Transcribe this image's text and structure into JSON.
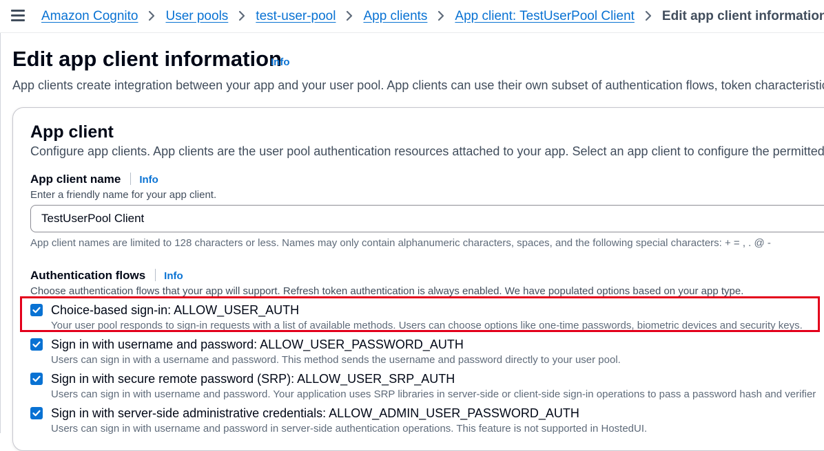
{
  "breadcrumbs": [
    {
      "label": "Amazon Cognito"
    },
    {
      "label": "User pools"
    },
    {
      "label": "test-user-pool"
    },
    {
      "label": "App clients"
    },
    {
      "label": "App client: TestUserPool Client"
    },
    {
      "label": "Edit app client information"
    }
  ],
  "page": {
    "title": "Edit app client information",
    "info_label": "Info",
    "description": "App clients create integration between your app and your user pool. App clients can use their own subset of authentication flows, token characteristics"
  },
  "app_client_panel": {
    "title": "App client",
    "description": "Configure app clients. App clients are the user pool authentication resources attached to your app. Select an app client to configure the permitted"
  },
  "client_name": {
    "label": "App client name",
    "info_label": "Info",
    "description": "Enter a friendly name for your app client.",
    "value": "TestUserPool Client",
    "constraint": "App client names are limited to 128 characters or less. Names may only contain alphanumeric characters, spaces, and the following special characters: + = , . @ -"
  },
  "auth_flows": {
    "label": "Authentication flows",
    "info_label": "Info",
    "description": "Choose authentication flows that your app will support. Refresh token authentication is always enabled. We have populated options based on your app type.",
    "items": [
      {
        "label": "Choice-based sign-in: ALLOW_USER_AUTH",
        "description": "Your user pool responds to sign-in requests with a list of available methods. Users can choose options like one-time passwords, biometric devices and security keys.",
        "checked": true
      },
      {
        "label": "Sign in with username and password: ALLOW_USER_PASSWORD_AUTH",
        "description": "Users can sign in with a username and password. This method sends the username and password directly to your user pool.",
        "checked": true
      },
      {
        "label": "Sign in with secure remote password (SRP): ALLOW_USER_SRP_AUTH",
        "description": "Users can sign in with username and password. Your application uses SRP libraries in server-side or client-side sign-in operations to pass a password hash and verifier",
        "checked": true
      },
      {
        "label": "Sign in with server-side administrative credentials: ALLOW_ADMIN_USER_PASSWORD_AUTH",
        "description": "Users can sign in with username and password in server-side authentication operations. This feature is not supported in HostedUI.",
        "checked": true
      }
    ]
  },
  "colors": {
    "link": "#0972d3",
    "checkbox": "#0972d3",
    "highlight": "#e3001b"
  },
  "icons": {
    "menu": "hamburger-menu-icon",
    "separator": "chevron-right-icon",
    "checkbox": "checkmark-icon"
  }
}
